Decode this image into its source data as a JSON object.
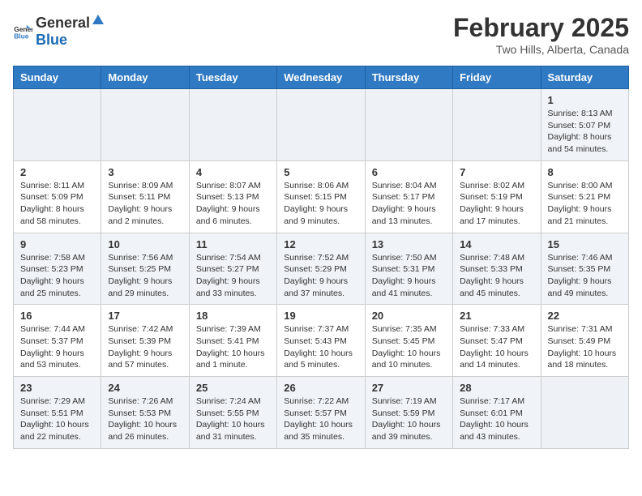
{
  "header": {
    "logo_general": "General",
    "logo_blue": "Blue",
    "month_title": "February 2025",
    "location": "Two Hills, Alberta, Canada"
  },
  "days_of_week": [
    "Sunday",
    "Monday",
    "Tuesday",
    "Wednesday",
    "Thursday",
    "Friday",
    "Saturday"
  ],
  "weeks": [
    {
      "days": [
        {
          "number": "",
          "info": ""
        },
        {
          "number": "",
          "info": ""
        },
        {
          "number": "",
          "info": ""
        },
        {
          "number": "",
          "info": ""
        },
        {
          "number": "",
          "info": ""
        },
        {
          "number": "",
          "info": ""
        },
        {
          "number": "1",
          "info": "Sunrise: 8:13 AM\nSunset: 5:07 PM\nDaylight: 8 hours and 54 minutes."
        }
      ]
    },
    {
      "days": [
        {
          "number": "2",
          "info": "Sunrise: 8:11 AM\nSunset: 5:09 PM\nDaylight: 8 hours and 58 minutes."
        },
        {
          "number": "3",
          "info": "Sunrise: 8:09 AM\nSunset: 5:11 PM\nDaylight: 9 hours and 2 minutes."
        },
        {
          "number": "4",
          "info": "Sunrise: 8:07 AM\nSunset: 5:13 PM\nDaylight: 9 hours and 6 minutes."
        },
        {
          "number": "5",
          "info": "Sunrise: 8:06 AM\nSunset: 5:15 PM\nDaylight: 9 hours and 9 minutes."
        },
        {
          "number": "6",
          "info": "Sunrise: 8:04 AM\nSunset: 5:17 PM\nDaylight: 9 hours and 13 minutes."
        },
        {
          "number": "7",
          "info": "Sunrise: 8:02 AM\nSunset: 5:19 PM\nDaylight: 9 hours and 17 minutes."
        },
        {
          "number": "8",
          "info": "Sunrise: 8:00 AM\nSunset: 5:21 PM\nDaylight: 9 hours and 21 minutes."
        }
      ]
    },
    {
      "days": [
        {
          "number": "9",
          "info": "Sunrise: 7:58 AM\nSunset: 5:23 PM\nDaylight: 9 hours and 25 minutes."
        },
        {
          "number": "10",
          "info": "Sunrise: 7:56 AM\nSunset: 5:25 PM\nDaylight: 9 hours and 29 minutes."
        },
        {
          "number": "11",
          "info": "Sunrise: 7:54 AM\nSunset: 5:27 PM\nDaylight: 9 hours and 33 minutes."
        },
        {
          "number": "12",
          "info": "Sunrise: 7:52 AM\nSunset: 5:29 PM\nDaylight: 9 hours and 37 minutes."
        },
        {
          "number": "13",
          "info": "Sunrise: 7:50 AM\nSunset: 5:31 PM\nDaylight: 9 hours and 41 minutes."
        },
        {
          "number": "14",
          "info": "Sunrise: 7:48 AM\nSunset: 5:33 PM\nDaylight: 9 hours and 45 minutes."
        },
        {
          "number": "15",
          "info": "Sunrise: 7:46 AM\nSunset: 5:35 PM\nDaylight: 9 hours and 49 minutes."
        }
      ]
    },
    {
      "days": [
        {
          "number": "16",
          "info": "Sunrise: 7:44 AM\nSunset: 5:37 PM\nDaylight: 9 hours and 53 minutes."
        },
        {
          "number": "17",
          "info": "Sunrise: 7:42 AM\nSunset: 5:39 PM\nDaylight: 9 hours and 57 minutes."
        },
        {
          "number": "18",
          "info": "Sunrise: 7:39 AM\nSunset: 5:41 PM\nDaylight: 10 hours and 1 minute."
        },
        {
          "number": "19",
          "info": "Sunrise: 7:37 AM\nSunset: 5:43 PM\nDaylight: 10 hours and 5 minutes."
        },
        {
          "number": "20",
          "info": "Sunrise: 7:35 AM\nSunset: 5:45 PM\nDaylight: 10 hours and 10 minutes."
        },
        {
          "number": "21",
          "info": "Sunrise: 7:33 AM\nSunset: 5:47 PM\nDaylight: 10 hours and 14 minutes."
        },
        {
          "number": "22",
          "info": "Sunrise: 7:31 AM\nSunset: 5:49 PM\nDaylight: 10 hours and 18 minutes."
        }
      ]
    },
    {
      "days": [
        {
          "number": "23",
          "info": "Sunrise: 7:29 AM\nSunset: 5:51 PM\nDaylight: 10 hours and 22 minutes."
        },
        {
          "number": "24",
          "info": "Sunrise: 7:26 AM\nSunset: 5:53 PM\nDaylight: 10 hours and 26 minutes."
        },
        {
          "number": "25",
          "info": "Sunrise: 7:24 AM\nSunset: 5:55 PM\nDaylight: 10 hours and 31 minutes."
        },
        {
          "number": "26",
          "info": "Sunrise: 7:22 AM\nSunset: 5:57 PM\nDaylight: 10 hours and 35 minutes."
        },
        {
          "number": "27",
          "info": "Sunrise: 7:19 AM\nSunset: 5:59 PM\nDaylight: 10 hours and 39 minutes."
        },
        {
          "number": "28",
          "info": "Sunrise: 7:17 AM\nSunset: 6:01 PM\nDaylight: 10 hours and 43 minutes."
        },
        {
          "number": "",
          "info": ""
        }
      ]
    }
  ]
}
